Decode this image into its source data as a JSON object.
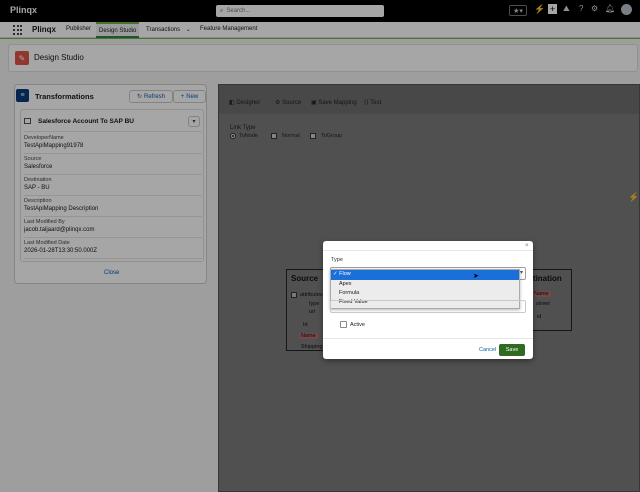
{
  "app": {
    "title": "Plinqx"
  },
  "search": {
    "placeholder": "Search..."
  },
  "nav": {
    "app_name": "Plinqx",
    "items": [
      "Publisher",
      "Design Studio",
      "Transactions",
      "Feature Management"
    ]
  },
  "page": {
    "title": "Design Studio"
  },
  "transformations": {
    "title": "Transformations",
    "refresh_label": "Refresh",
    "new_label": "New",
    "record_title": "Salesforce Account To SAP BU",
    "fields": [
      {
        "label": "DeveloperName",
        "value": "TestApiMapping91978"
      },
      {
        "label": "Source",
        "value": "Salesforce"
      },
      {
        "label": "Destination",
        "value": "SAP - BU"
      },
      {
        "label": "Description",
        "value": "TestApiMapping Description"
      },
      {
        "label": "Last Modified By",
        "value": "jacob.taljaard@plinqx.com"
      },
      {
        "label": "Last Modified Date",
        "value": "2026-01-28T13:30:50.000Z"
      }
    ],
    "close_label": "Close"
  },
  "toolbar": {
    "designer": "Designer",
    "source": "Source",
    "save_mapping": "Save Mapping",
    "test": "Test"
  },
  "link_type": {
    "label": "Link Type",
    "options": [
      "ToNode",
      "Normal",
      "ToGroup"
    ]
  },
  "source_node": {
    "title": "Source",
    "items": [
      "attributes",
      "type",
      "url",
      "Id",
      "Name",
      "Shipping"
    ]
  },
  "destination_node": {
    "title": "estination",
    "items": [
      "Name",
      "street",
      "id"
    ]
  },
  "modal": {
    "type_label": "Type",
    "options": [
      "Flow",
      "Apex",
      "Formula",
      "Fixed Value"
    ],
    "selected": "Flow",
    "active_label": "Active",
    "cancel_label": "Cancel",
    "save_label": "Save"
  },
  "colors": {
    "accent": "#0b5cab",
    "save": "#2e844a",
    "header_icon": "#e0534a",
    "top_bar": "#000000"
  }
}
